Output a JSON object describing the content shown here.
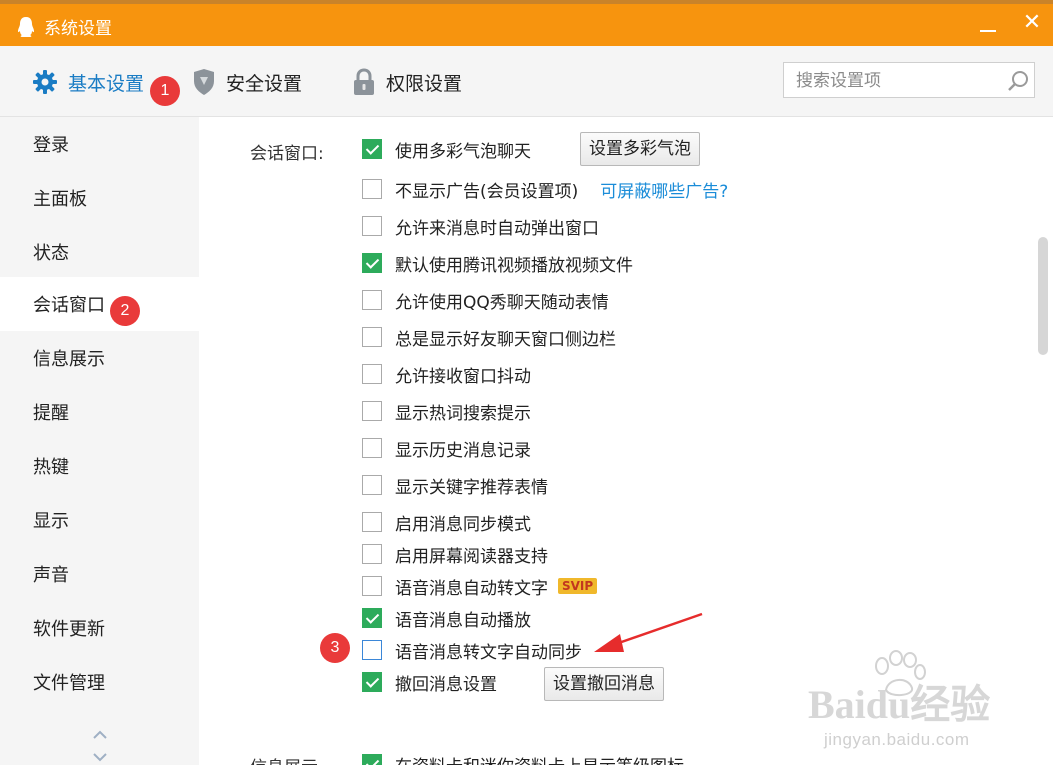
{
  "window": {
    "title": "系统设置"
  },
  "tabs": [
    {
      "label": "基本设置",
      "active": true,
      "icon": "gear-icon"
    },
    {
      "label": "安全设置",
      "active": false,
      "icon": "shield-icon"
    },
    {
      "label": "权限设置",
      "active": false,
      "icon": "lock-icon"
    }
  ],
  "search": {
    "placeholder": "搜索设置项",
    "value": ""
  },
  "badges": {
    "one": "1",
    "two": "2",
    "three": "3"
  },
  "sidebar": {
    "items": [
      {
        "label": "登录"
      },
      {
        "label": "主面板"
      },
      {
        "label": "状态"
      },
      {
        "label": "会话窗口",
        "active": true
      },
      {
        "label": "信息展示"
      },
      {
        "label": "提醒"
      },
      {
        "label": "热键"
      },
      {
        "label": "显示"
      },
      {
        "label": "声音"
      },
      {
        "label": "软件更新"
      },
      {
        "label": "文件管理"
      }
    ]
  },
  "section": {
    "label": "会话窗口:",
    "options": [
      {
        "label": "使用多彩气泡聊天",
        "checked": true
      },
      {
        "label": "不显示广告(会员设置项)",
        "checked": false
      },
      {
        "label": "允许来消息时自动弹出窗口",
        "checked": false
      },
      {
        "label": "默认使用腾讯视频播放视频文件",
        "checked": true
      },
      {
        "label": "允许使用QQ秀聊天随动表情",
        "checked": false
      },
      {
        "label": "总是显示好友聊天窗口侧边栏",
        "checked": false
      },
      {
        "label": "允许接收窗口抖动",
        "checked": false
      },
      {
        "label": "显示热词搜索提示",
        "checked": false
      },
      {
        "label": "显示历史消息记录",
        "checked": false
      },
      {
        "label": "显示关键字推荐表情",
        "checked": false
      },
      {
        "label": "启用消息同步模式",
        "checked": false
      },
      {
        "label": "启用屏幕阅读器支持",
        "checked": false
      },
      {
        "label": "语音消息自动转文字",
        "checked": false
      },
      {
        "label": "语音消息自动播放",
        "checked": true
      },
      {
        "label": "语音消息转文字自动同步",
        "checked": false
      },
      {
        "label": "撤回消息设置",
        "checked": true
      }
    ],
    "bubble_button": "设置多彩气泡",
    "ad_link": "可屏蔽哪些广告?",
    "vip_badge": "SVIP",
    "recall_button": "设置撤回消息"
  },
  "next_section": {
    "label": "信息展示",
    "option": "在资料卡和迷你资料卡上显示等级图标",
    "checked": true
  },
  "watermark": {
    "main": "Baidu经验",
    "sub": "jingyan.baidu.com"
  },
  "colors": {
    "titlebar": "#f7940e",
    "accent": "#1a7cc4",
    "check": "#2dab5b",
    "badge": "#e93a3a"
  }
}
